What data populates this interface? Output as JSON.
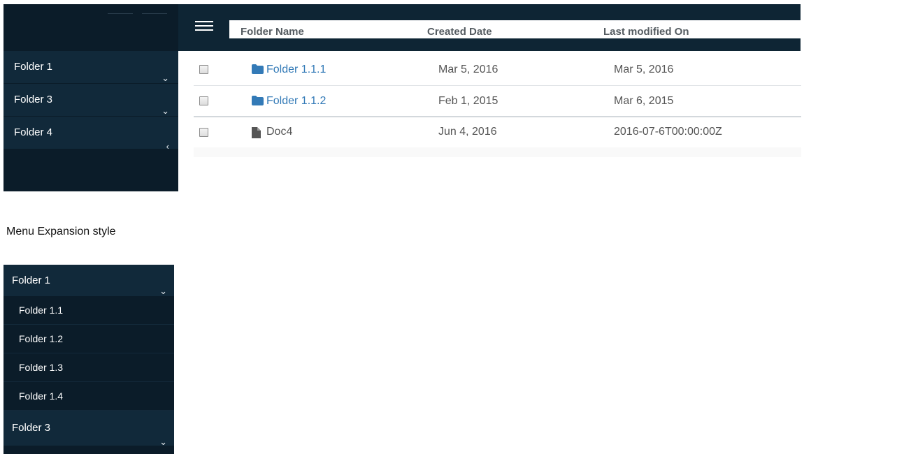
{
  "sidebar": {
    "items": [
      {
        "label": "Folder 1",
        "chevron": "⌄"
      },
      {
        "label": "Folder 3",
        "chevron": "⌄"
      },
      {
        "label": "Folder 4",
        "chevron": "‹"
      }
    ]
  },
  "table": {
    "headers": {
      "name": "Folder Name",
      "created": "Created Date",
      "modified": "Last modified On"
    },
    "rows": [
      {
        "icon": "folder-icon",
        "name": "Folder 1.1.1",
        "created": "Mar 5, 2016",
        "modified": "Mar 5, 2016"
      },
      {
        "icon": "folder-icon",
        "name": "Folder 1.1.2",
        "created": "Feb 1, 2015",
        "modified": "Mar 6, 2015"
      },
      {
        "icon": "file-icon",
        "name": "Doc4",
        "created": "Jun 4, 2016",
        "modified": "2016-07-6T00:00:00Z"
      }
    ]
  },
  "caption": "Menu Expansion style",
  "expanded_menu": {
    "parent": {
      "label": "Folder 1",
      "chevron": "⌄"
    },
    "children": [
      "Folder 1.1",
      "Folder 1.2",
      "Folder 1.3",
      "Folder 1.4"
    ],
    "next": {
      "label": "Folder 3",
      "chevron": "⌄"
    }
  },
  "colors": {
    "sidebar_bg": "#0b1c29",
    "item_bg": "#11293a",
    "topbar": "#0e2534",
    "link": "#337ab7"
  }
}
